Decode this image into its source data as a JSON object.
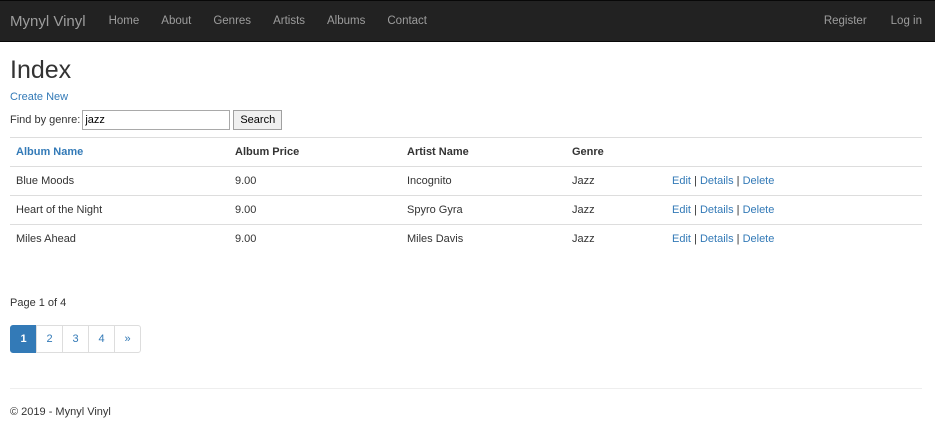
{
  "navbar": {
    "brand": "Mynyl Vinyl",
    "links": [
      "Home",
      "About",
      "Genres",
      "Artists",
      "Albums",
      "Contact"
    ],
    "register": "Register",
    "login": "Log in",
    "background": "#222222",
    "text_color": "#9d9d9d"
  },
  "page": {
    "title": "Index",
    "create_new": "Create New"
  },
  "search": {
    "label": "Find by genre:",
    "value": "jazz",
    "button": "Search"
  },
  "table": {
    "headers": [
      "Album Name",
      "Album Price",
      "Artist Name",
      "Genre"
    ],
    "rows": [
      {
        "name": "Blue Moods",
        "price": "9.00",
        "artist": "Incognito",
        "genre": "Jazz"
      },
      {
        "name": "Heart of the Night",
        "price": "9.00",
        "artist": "Spyro Gyra",
        "genre": "Jazz"
      },
      {
        "name": "Miles Ahead",
        "price": "9.00",
        "artist": "Miles Davis",
        "genre": "Jazz"
      }
    ],
    "actions": {
      "edit": "Edit",
      "details": "Details",
      "delete": "Delete",
      "separator": "|"
    }
  },
  "pagination": {
    "info": "Page 1 of 4",
    "pages": [
      "1",
      "2",
      "3",
      "4",
      "»"
    ],
    "current": "1",
    "accent": "#337ab7"
  },
  "footer": {
    "text": "© 2019 - Mynyl Vinyl"
  }
}
